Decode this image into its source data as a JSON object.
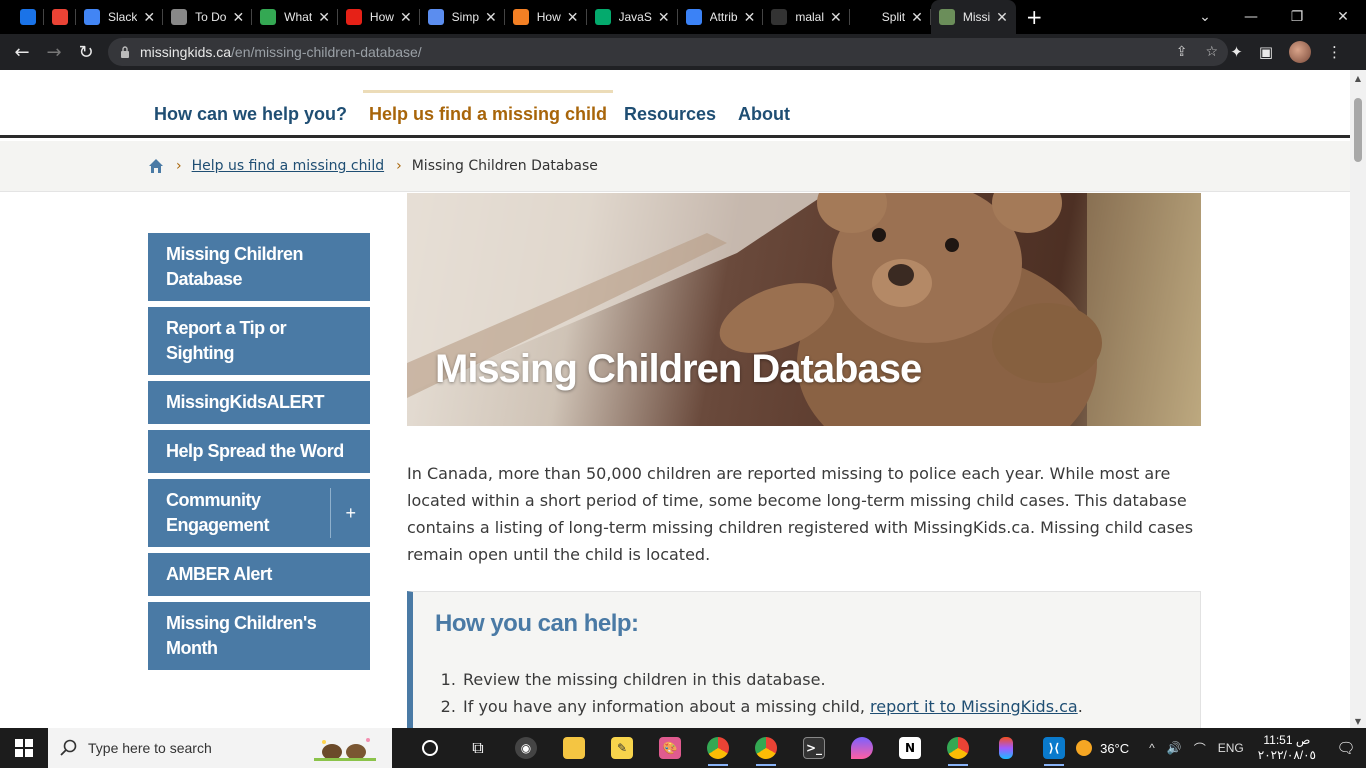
{
  "browser": {
    "tabs": [
      {
        "label": "",
        "icon": "google-drive-icon",
        "color": "#1a73e8"
      },
      {
        "label": "",
        "icon": "gmail-icon",
        "color": "#ea4335"
      },
      {
        "label": "Slack",
        "icon": "google-icon",
        "color": "#4285f4"
      },
      {
        "label": "To Do",
        "icon": "globe-icon",
        "color": "#888888"
      },
      {
        "label": "What",
        "icon": "chrome-icon",
        "color": "#34a853"
      },
      {
        "label": "How",
        "icon": "youtube-icon",
        "color": "#e62117"
      },
      {
        "label": "Simp",
        "icon": "cloud-icon",
        "color": "#5b8def"
      },
      {
        "label": "How",
        "icon": "stackoverflow-icon",
        "color": "#f48024"
      },
      {
        "label": "JavaS",
        "icon": "w3schools-icon",
        "color": "#04aa6d"
      },
      {
        "label": "Attrib",
        "icon": "blue-icon",
        "color": "#3b82f6"
      },
      {
        "label": "malal",
        "icon": "github-icon",
        "color": "#333333"
      },
      {
        "label": "Split",
        "icon": "blank-icon",
        "color": "#000000"
      },
      {
        "label": "Missi",
        "icon": "missingkids-icon",
        "color": "#6b8e5a"
      }
    ],
    "url_domain": "missingkids.ca",
    "url_path": "/en/missing-children-database/"
  },
  "site": {
    "nav": [
      {
        "label": "How can we help you?"
      },
      {
        "label": "Help us find a missing child"
      },
      {
        "label": "Resources"
      },
      {
        "label": "About"
      }
    ],
    "breadcrumb": {
      "link": "Help us find a missing child",
      "current": "Missing Children Database"
    },
    "sidemenu": [
      "Missing Children Database",
      "Report a Tip or Sighting",
      "MissingKidsALERT",
      "Help Spread the Word",
      "Community Engagement",
      "AMBER Alert",
      "Missing Children's Month"
    ],
    "sidemenu_expand": "+",
    "hero_title": "Missing Children Database",
    "intro": "In Canada, more than 50,000 children are reported missing to police each year. While most are located within a short period of time, some become long-term missing child cases. This database contains a listing of long-term missing children registered with MissingKids.ca. Missing child cases remain open until the child is located.",
    "help": {
      "title": "How you can help:",
      "item1": "Review the missing children in this database.",
      "item2_prefix": "If you have any information about a missing child, ",
      "item2_link": "report it to MissingKids.ca",
      "item2_suffix": "."
    },
    "colors": {
      "nav_blue": "#1f4e73",
      "nav_active": "#a8650a",
      "menu_blue": "#4a7aa5"
    }
  },
  "taskbar": {
    "search_placeholder": "Type here to search",
    "temperature": "36°C",
    "language": "ENG",
    "time": "11:51 ص",
    "date": "٢٠٢٢/٠٨/٠٥"
  }
}
